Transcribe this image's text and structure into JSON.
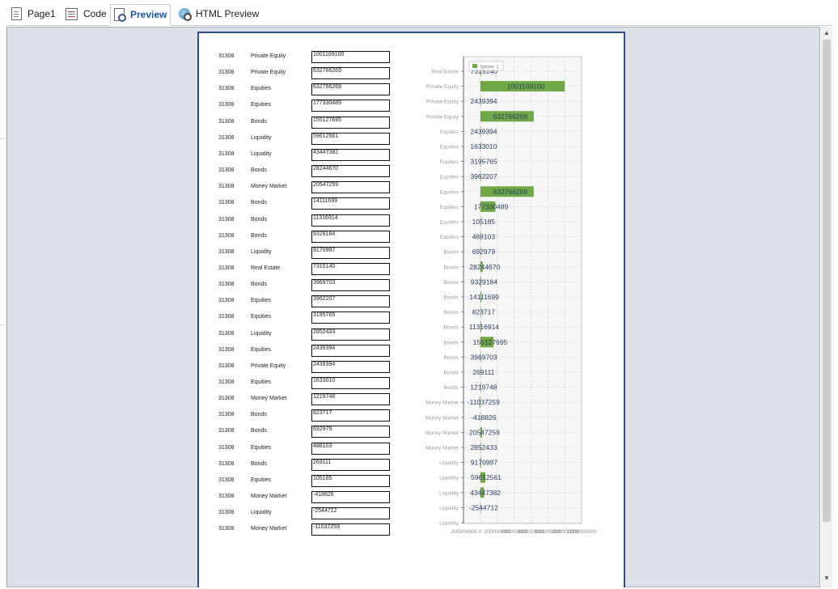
{
  "tabs": [
    {
      "label": "Page1",
      "icon": "page-icon"
    },
    {
      "label": "Code",
      "icon": "code-icon"
    },
    {
      "label": "Preview",
      "icon": "preview-icon",
      "active": true
    },
    {
      "label": "HTML Preview",
      "icon": "html-preview-icon"
    }
  ],
  "accent_color": "#1a55a6",
  "page_border_color": "#2b4f8a",
  "report_rows": [
    {
      "id": "31308",
      "type": "Private Equity",
      "value": "1001169100"
    },
    {
      "id": "31308",
      "type": "Private Equity",
      "value": "632766269"
    },
    {
      "id": "31308",
      "type": "Equities",
      "value": "632766269"
    },
    {
      "id": "31308",
      "type": "Equities",
      "value": "177330489"
    },
    {
      "id": "31308",
      "type": "Bonds",
      "value": "155127695"
    },
    {
      "id": "31308",
      "type": "Liquidity",
      "value": "59612561"
    },
    {
      "id": "31308",
      "type": "Liquidity",
      "value": "43447382"
    },
    {
      "id": "31308",
      "type": "Bonds",
      "value": "28244670"
    },
    {
      "id": "31308",
      "type": "Money Market",
      "value": "20547259"
    },
    {
      "id": "31308",
      "type": "Bonds",
      "value": "14111699"
    },
    {
      "id": "31308",
      "type": "Bonds",
      "value": "11316914"
    },
    {
      "id": "31308",
      "type": "Bonds",
      "value": "9329184"
    },
    {
      "id": "31308",
      "type": "Liquidity",
      "value": "9170997"
    },
    {
      "id": "31308",
      "type": "Real Estate",
      "value": "7315140"
    },
    {
      "id": "31308",
      "type": "Bonds",
      "value": "3969703"
    },
    {
      "id": "31308",
      "type": "Equities",
      "value": "3962207"
    },
    {
      "id": "31308",
      "type": "Equities",
      "value": "3195765"
    },
    {
      "id": "31308",
      "type": "Liquidity",
      "value": "2852433"
    },
    {
      "id": "31308",
      "type": "Equities",
      "value": "2439394"
    },
    {
      "id": "31308",
      "type": "Private Equity",
      "value": "2439394"
    },
    {
      "id": "31308",
      "type": "Equities",
      "value": "1633010"
    },
    {
      "id": "31308",
      "type": "Money Market",
      "value": "1219748"
    },
    {
      "id": "31308",
      "type": "Bonds",
      "value": "823717"
    },
    {
      "id": "31308",
      "type": "Bonds",
      "value": "692979"
    },
    {
      "id": "31308",
      "type": "Equities",
      "value": "488103"
    },
    {
      "id": "31308",
      "type": "Bonds",
      "value": "269111"
    },
    {
      "id": "31308",
      "type": "Equities",
      "value": "105185"
    },
    {
      "id": "31308",
      "type": "Money Market",
      "value": "-418826"
    },
    {
      "id": "31308",
      "type": "Liquidity",
      "value": "-2544712"
    },
    {
      "id": "31308",
      "type": "Money Market",
      "value": "-11037259"
    }
  ],
  "chart_data": {
    "type": "bar",
    "orientation": "horizontal",
    "categories": [
      "Real Estate",
      "Private Equity",
      "Private Equity",
      "Private Equity",
      "Equities",
      "Equities",
      "Equities",
      "Equities",
      "Equities",
      "Equities",
      "Equities",
      "Equities",
      "Bonds",
      "Bonds",
      "Bonds",
      "Bonds",
      "Bonds",
      "Bonds",
      "Bonds",
      "Bonds",
      "Bonds",
      "Bonds",
      "Money Market",
      "Money Market",
      "Money Market",
      "Money Market",
      "Liquidity",
      "Liquidity",
      "Liquidity",
      "Liquidity",
      "Liquidity"
    ],
    "value_labels": [
      "7315140",
      "1001169100",
      "2439394",
      "632766269",
      "2439394",
      "1633010",
      "3195765",
      "3962207",
      "632766269",
      "177330489",
      "105185",
      "488103",
      "692979",
      "28244670",
      "9329184",
      "14111699",
      "823717",
      "11316914",
      "155127695",
      "3969703",
      "269111",
      "1219748",
      "-11037259",
      "-418826",
      "20547259",
      "2852433",
      "9170997",
      "59612561",
      "43447382",
      "-2544712"
    ],
    "series": [
      {
        "name": "Series 1",
        "color": "#70a846",
        "values": [
          7315140,
          1001169100,
          2439394,
          632766269,
          2439394,
          1633010,
          3195765,
          3962207,
          632766269,
          177330489,
          105185,
          488103,
          692979,
          28244670,
          9329184,
          14111699,
          823717,
          11316914,
          155127695,
          3969703,
          269111,
          1219748,
          -11037259,
          -418826,
          20547259,
          2852433,
          9170997,
          59612561,
          43447382,
          -2544712
        ]
      }
    ],
    "xlim": [
      -200000000,
      1200000000
    ],
    "x_tick_labels": [
      "-200000000",
      "0",
      "200000000",
      "400000000",
      "600000000",
      "800000000",
      "1000000000",
      "1200000000"
    ],
    "legend": "top-left",
    "grid": true
  }
}
